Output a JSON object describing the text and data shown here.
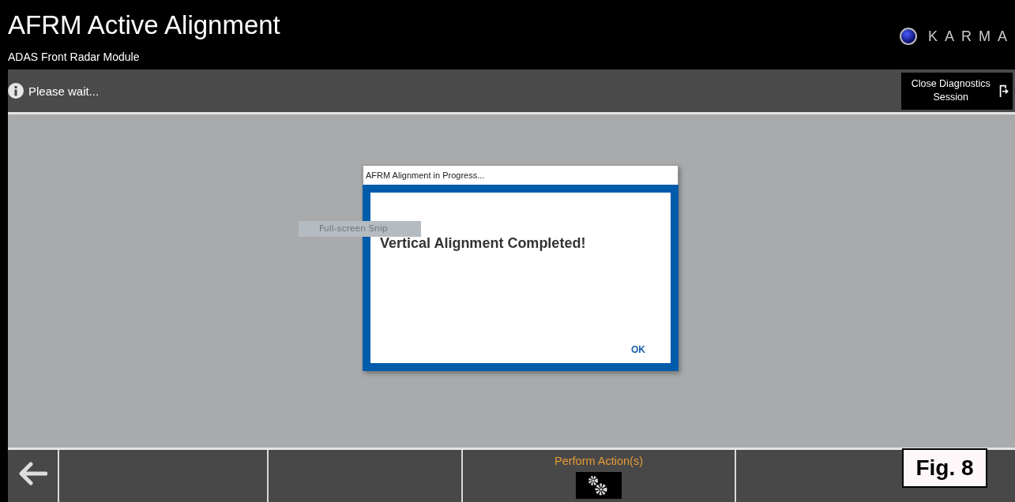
{
  "header": {
    "title": "AFRM Active Alignment",
    "subtitle": "ADAS Front Radar Module",
    "brand": "KARMA"
  },
  "status_bar": {
    "message": "Please wait...",
    "close_button": "Close Diagnostics Session"
  },
  "tooltip": {
    "text": "Full-screen Snip"
  },
  "dialog": {
    "title": "AFRM Alignment in Progress...",
    "message": "Vertical Alignment Completed!",
    "button": "OK"
  },
  "toolbar": [
    {
      "kind": "back"
    },
    {
      "kind": "empty"
    },
    {
      "kind": "empty"
    },
    {
      "kind": "action",
      "label": "Perform Action(s)"
    },
    {
      "kind": "empty"
    }
  ],
  "figure_label": "Fig. 8"
}
